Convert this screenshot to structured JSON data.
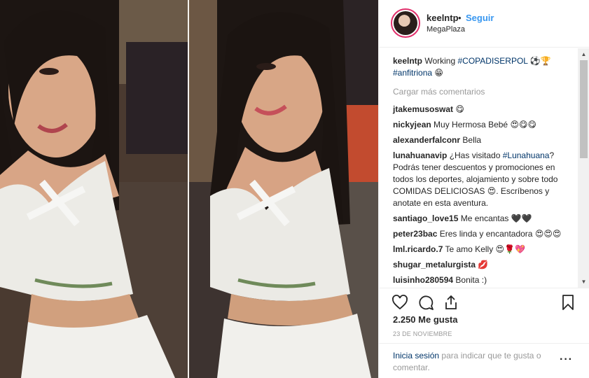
{
  "header": {
    "username": "keelntp",
    "separator": "•",
    "follow_label": "Seguir",
    "location": "MegaPlaza"
  },
  "caption": {
    "username": "keelntp",
    "text_1": "Working",
    "tag_1": "#COPADISERPOL",
    "emoji_1": "⚽🏆",
    "tag_2": "#anfitriona",
    "emoji_2": "😁"
  },
  "load_more": "Cargar más comentarios",
  "comments": [
    {
      "user": "jtakemusoswat",
      "text": "",
      "emoji": "😋"
    },
    {
      "user": "nickyjean",
      "text": "Muy Hermosa Bebé",
      "emoji": "😍😋😋"
    },
    {
      "user": "alexanderfalconr",
      "text": "Bella",
      "emoji": ""
    },
    {
      "user": "lunahuanavip",
      "text": "¿Has visitado",
      "tag": "#Lunahuana",
      "text_after": "? Podrás tener descuentos y promociones en todos los deportes, alojamiento y sobre todo COMIDAS DELICIOSAS",
      "emoji": "😍",
      "text_end": ". Escríbenos y anotate en esta aventura."
    },
    {
      "user": "santiago_love15",
      "text": "Me encantas",
      "emoji": "🖤🖤"
    },
    {
      "user": "peter23bac",
      "text": "Eres linda y encantadora",
      "emoji": "😍😍😍"
    },
    {
      "user": "lml.ricardo.7",
      "text": "Te amo Kelly",
      "emoji": "😍🌹💖"
    },
    {
      "user": "shugar_metalurgista",
      "text": "",
      "emoji": "💋"
    },
    {
      "user": "luisinho280594",
      "text": "Bonita :)",
      "emoji": ""
    }
  ],
  "likes_text": "2.250 Me gusta",
  "date_text": "23 DE NOVIEMBRE",
  "login": {
    "link": "Inicia sesión",
    "text": "para indicar que te gusta o comentar."
  },
  "icons": {
    "like": "heart-icon",
    "comment": "comment-icon",
    "share": "share-icon",
    "save": "bookmark-icon",
    "more": "more-icon"
  },
  "colors": {
    "accent": "#3897f0",
    "link": "#003569",
    "muted": "#999999",
    "border": "#efefef"
  }
}
